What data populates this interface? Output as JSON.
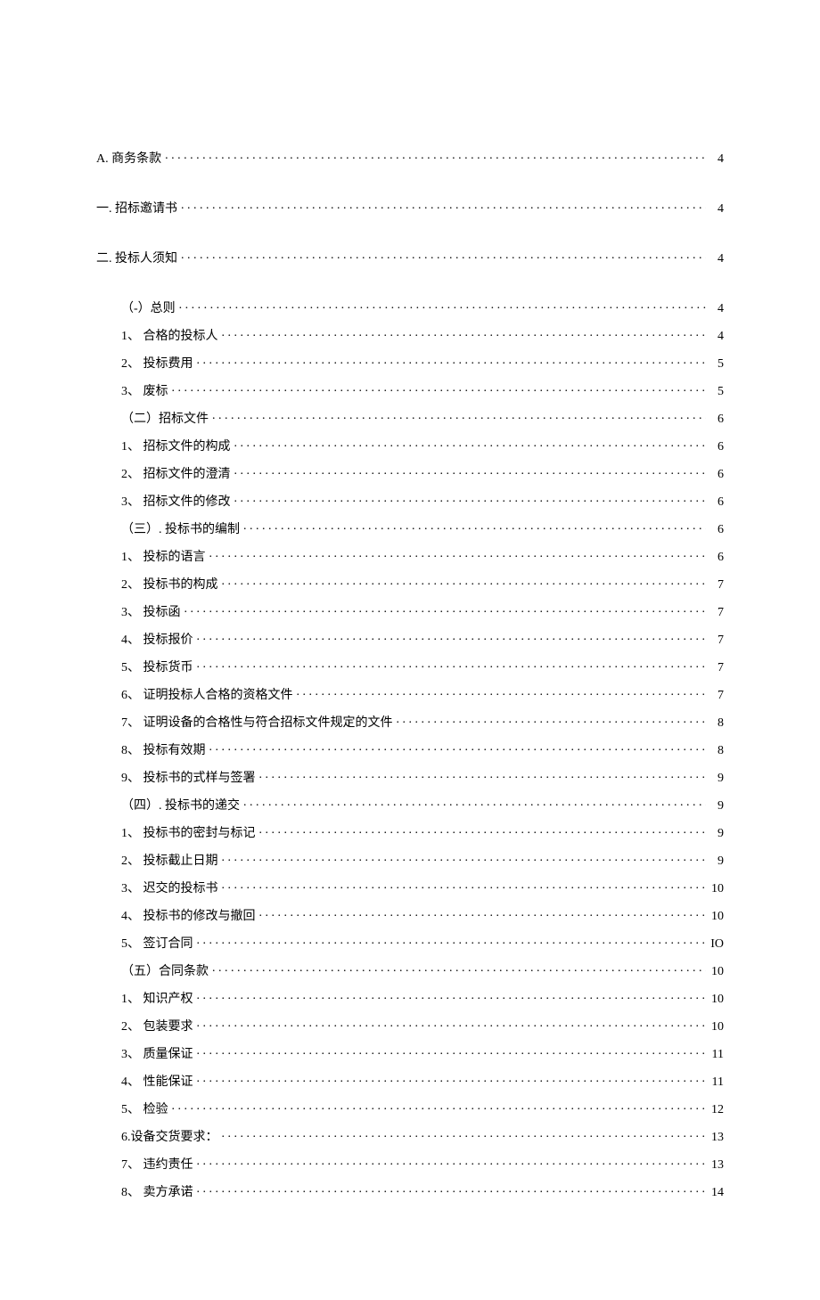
{
  "toc": [
    {
      "level": 0,
      "label": "A. 商务条款",
      "page": "4"
    },
    {
      "level": 0,
      "label": "一. 招标邀请书",
      "page": "4"
    },
    {
      "level": 0,
      "label": "二. 投标人须知",
      "page": "4"
    },
    {
      "level": 1,
      "label": "（-）总则",
      "page": "4"
    },
    {
      "level": 1,
      "label": "1、 合格的投标人",
      "page": "4"
    },
    {
      "level": 1,
      "label": "2、 投标费用",
      "page": "5"
    },
    {
      "level": 1,
      "label": "3、 废标",
      "page": "5"
    },
    {
      "level": 1,
      "label": "（二）招标文件",
      "page": "6"
    },
    {
      "level": 1,
      "label": "1、 招标文件的构成",
      "page": "6"
    },
    {
      "level": 1,
      "label": "2、 招标文件的澄清",
      "page": "6"
    },
    {
      "level": 1,
      "label": "3、 招标文件的修改",
      "page": "6"
    },
    {
      "level": 1,
      "label": "（三）. 投标书的编制",
      "page": "6"
    },
    {
      "level": 1,
      "label": "1、 投标的语言",
      "page": "6"
    },
    {
      "level": 1,
      "label": "2、 投标书的构成",
      "page": "7"
    },
    {
      "level": 1,
      "label": "3、 投标函",
      "page": "7"
    },
    {
      "level": 1,
      "label": "4、 投标报价",
      "page": "7"
    },
    {
      "level": 1,
      "label": "5、 投标货币",
      "page": "7"
    },
    {
      "level": 1,
      "label": "6、 证明投标人合格的资格文件",
      "page": "7"
    },
    {
      "level": 1,
      "label": "7、 证明设备的合格性与符合招标文件规定的文件",
      "page": "8"
    },
    {
      "level": 1,
      "label": "8、 投标有效期",
      "page": "8"
    },
    {
      "level": 1,
      "label": "9、 投标书的式样与签署",
      "page": "9"
    },
    {
      "level": 1,
      "label": "（四）. 投标书的递交",
      "page": "9"
    },
    {
      "level": 1,
      "label": "1、 投标书的密封与标记",
      "page": "9"
    },
    {
      "level": 1,
      "label": "2、 投标截止日期",
      "page": "9"
    },
    {
      "level": 1,
      "label": "3、 迟交的投标书",
      "page": "10"
    },
    {
      "level": 1,
      "label": "4、 投标书的修改与撤回",
      "page": "10"
    },
    {
      "level": 1,
      "label": "5、 签订合同",
      "page": "IO"
    },
    {
      "level": 1,
      "label": "（五）合同条款",
      "page": "10"
    },
    {
      "level": 1,
      "label": "1、 知识产权",
      "page": "10"
    },
    {
      "level": 1,
      "label": "2、 包装要求",
      "page": "10"
    },
    {
      "level": 1,
      "label": "3、 质量保证",
      "page": "11"
    },
    {
      "level": 1,
      "label": "4、 性能保证",
      "page": "11"
    },
    {
      "level": 1,
      "label": "5、 检验",
      "page": "12"
    },
    {
      "level": 1,
      "label": "6.设备交货要求：",
      "page": "13"
    },
    {
      "level": 1,
      "label": "7、 违约责任",
      "page": "13"
    },
    {
      "level": 1,
      "label": "8、 卖方承诺",
      "page": "14"
    }
  ]
}
